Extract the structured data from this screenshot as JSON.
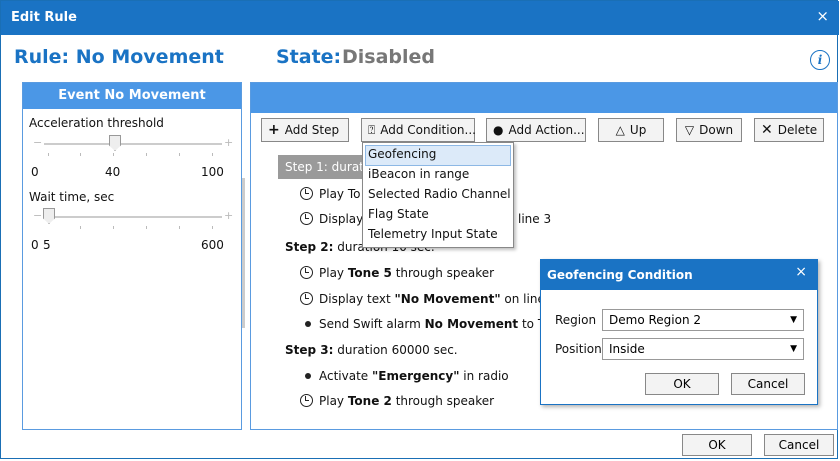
{
  "window": {
    "title": "Edit Rule",
    "close": "×"
  },
  "header": {
    "rule": "Rule: No Movement",
    "state_label": "State:",
    "state_value": "Disabled",
    "info": "i"
  },
  "event": {
    "title": "Event  No Movement",
    "accel": {
      "label": "Acceleration threshold",
      "min": "0",
      "value": "40",
      "max": "100"
    },
    "wait": {
      "label": "Wait time, sec",
      "min": "0",
      "value": "5",
      "max": "600"
    }
  },
  "toolbar": {
    "add_step": "Add Step",
    "add_condition": "Add Condition...",
    "add_action": "Add Action...",
    "up": "Up",
    "down": "Down",
    "delete": "Delete"
  },
  "steps": {
    "step1": {
      "prefix": "Step 1:",
      "hidden": "durat"
    },
    "s1_play": "Play To",
    "s1_display": "Display",
    "s1_display_tail": "line 3",
    "step2": "Step 2:",
    "step2_tail": "duration 10 sec.",
    "s2_play_a": "Play ",
    "s2_play_b": "Tone 5",
    "s2_play_c": " through speaker",
    "s2_disp_a": "Display text ",
    "s2_disp_b": "\"No Movement\"",
    "s2_disp_c": " on line",
    "s2_send_a": "Send Swift alarm ",
    "s2_send_b": "No Movement",
    "s2_send_c": " to T",
    "step3": "Step 3:",
    "step3_tail": "duration 60000 sec.",
    "s3_act_a": "Activate ",
    "s3_act_b": "\"Emergency\"",
    "s3_act_c": " in radio",
    "s3_play_a": "Play ",
    "s3_play_b": "Tone 2",
    "s3_play_c": " through speaker"
  },
  "dropdown": [
    "Geofencing",
    "iBeacon in range",
    "Selected Radio Channel",
    "Flag State",
    "Telemetry Input State"
  ],
  "geo_dialog": {
    "title": "Geofencing Condition",
    "close": "×",
    "region_label": "Region",
    "region_value": "Demo Region 2",
    "position_label": "Position",
    "position_value": "Inside",
    "ok": "OK",
    "cancel": "Cancel"
  },
  "footer": {
    "ok": "OK",
    "cancel": "Cancel"
  }
}
